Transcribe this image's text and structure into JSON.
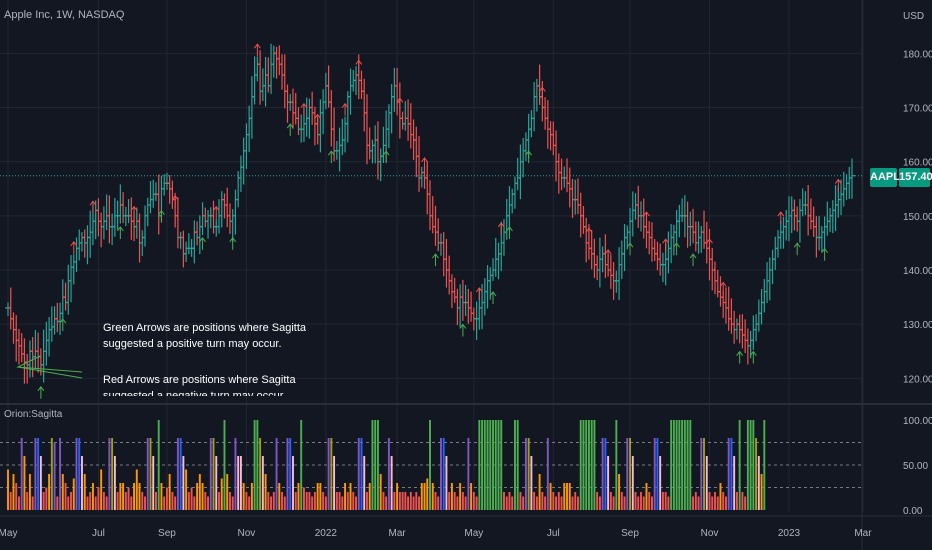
{
  "header": {
    "symbol": "Apple Inc, 1W, NASDAQ",
    "currency": "USD",
    "indicator": "Orion:Sagitta"
  },
  "badges": {
    "ticker": "AAPL",
    "last_price": "157.40"
  },
  "notes": {
    "green": "Green Arrows are positions where Sagitta suggested a positive turn may occur.",
    "red": "Red Arrows are positions where Sagitta suggested a negative turn may occur."
  },
  "colors": {
    "up": "#26a69a",
    "down": "#ef5350",
    "grid": "#222631",
    "arrow_up": "#4caf50",
    "arrow_down": "#ef5350",
    "hist_green": "#4caf50",
    "hist_red": "#ef5350",
    "hist_orange": "#ff9800",
    "hist_pink": "#f8bbd0",
    "hist_purple": "#7e57c2",
    "hist_blue": "#2962ff",
    "hist_olive": "#9e9d24",
    "last_line": "#26a69a"
  },
  "chart_data": [
    {
      "type": "ohlc",
      "title": "Apple Inc, 1W, NASDAQ",
      "x_axis": {
        "ticks": [
          "May",
          "Jul",
          "Sep",
          "Nov",
          "2022",
          "Mar",
          "May",
          "Jul",
          "Sep",
          "Nov",
          "2023",
          "Mar",
          "Ma"
        ],
        "tick_bar_index": [
          0,
          33,
          58,
          87,
          116,
          142,
          170,
          199,
          227,
          256,
          285,
          312,
          340
        ]
      },
      "y_axis": {
        "ticks": [
          120,
          130,
          140,
          150,
          160,
          170,
          180
        ],
        "unit": "USD",
        "ylim": [
          116,
          188
        ]
      },
      "last_price": 157.4,
      "closes": [
        133.0,
        131.0,
        129.0,
        127.0,
        126.0,
        124.5,
        123.0,
        122.5,
        125.0,
        124.0,
        125.0,
        124.0,
        122.5,
        125.0,
        127.0,
        129.0,
        129.5,
        131.0,
        130.5,
        132.0,
        135.0,
        134.0,
        138.0,
        140.5,
        141.5,
        144.0,
        145.0,
        146.0,
        145.0,
        146.0,
        147.0,
        149.0,
        151.0,
        149.0,
        148.0,
        149.0,
        150.0,
        148.0,
        148.0,
        150.0,
        150.0,
        152.0,
        150.0,
        150.0,
        150.0,
        149.0,
        148.0,
        149.0,
        145.0,
        146.0,
        150.0,
        152.0,
        153.0,
        154.0,
        154.0,
        150.0,
        155.0,
        156.0,
        156.0,
        155.0,
        153.0,
        150.0,
        146.0,
        146.0,
        143.0,
        144.0,
        144.0,
        144.0,
        147.0,
        146.0,
        148.0,
        150.0,
        149.0,
        150.0,
        150.0,
        148.0,
        148.0,
        150.0,
        153.0,
        152.0,
        150.0,
        149.0,
        150.0,
        153.0,
        157.0,
        159.0,
        162.0,
        165.0,
        168.0,
        172.0,
        176.0,
        178.0,
        173.0,
        174.0,
        176.0,
        174.0,
        178.0,
        180.0,
        179.0,
        178.0,
        176.0,
        173.0,
        171.0,
        171.0,
        169.0,
        168.0,
        166.0,
        166.0,
        167.0,
        168.0,
        170.0,
        169.0,
        167.0,
        165.0,
        169.0,
        171.0,
        174.0,
        171.0,
        166.0,
        162.0,
        162.0,
        163.0,
        164.0,
        167.0,
        172.0,
        174.0,
        175.0,
        176.0,
        175.0,
        173.0,
        169.0,
        163.0,
        162.0,
        163.0,
        164.0,
        160.0,
        161.0,
        163.0,
        166.0,
        169.0,
        172.0,
        174.0,
        171.0,
        168.0,
        167.0,
        168.0,
        167.0,
        165.0,
        164.0,
        161.0,
        157.0,
        158.0,
        157.0,
        154.0,
        150.0,
        148.0,
        147.0,
        145.0,
        145.0,
        142.0,
        140.0,
        138.0,
        136.0,
        135.0,
        133.0,
        135.0,
        134.0,
        134.0,
        133.0,
        132.0,
        131.0,
        131.0,
        133.0,
        134.0,
        136.0,
        138.0,
        139.0,
        140.0,
        142.0,
        143.0,
        145.0,
        147.0,
        150.0,
        152.0,
        154.0,
        156.0,
        157.0,
        160.0,
        162.0,
        164.0,
        166.0,
        168.0,
        172.0,
        174.0,
        172.0,
        170.0,
        168.0,
        166.0,
        165.0,
        163.0,
        160.0,
        158.0,
        157.0,
        157.0,
        156.0,
        155.0,
        153.0,
        153.0,
        152.0,
        150.0,
        148.0,
        145.0,
        144.0,
        143.0,
        141.0,
        140.0,
        142.0,
        143.0,
        141.0,
        140.0,
        139.0,
        138.0,
        138.0,
        141.0,
        143.0,
        146.0,
        147.0,
        149.0,
        151.0,
        152.0,
        150.0,
        150.0,
        148.0,
        147.0,
        146.0,
        144.0,
        143.0,
        142.0,
        141.0,
        141.0,
        142.0,
        144.0,
        146.0,
        147.0,
        149.0,
        150.0,
        150.0,
        150.0,
        148.0,
        148.0,
        147.0,
        145.0,
        146.0,
        147.0,
        145.0,
        144.0,
        142.0,
        140.0,
        138.0,
        136.0,
        135.0,
        134.0,
        133.0,
        131.0,
        130.0,
        129.0,
        130.0,
        129.0,
        128.0,
        127.0,
        126.0,
        127.0,
        129.0,
        130.0,
        132.0,
        134.0,
        136.0,
        138.0,
        140.0,
        142.0,
        144.0,
        146.0,
        147.0,
        148.0,
        149.0,
        150.0,
        151.0,
        150.0,
        149.0,
        151.0,
        152.0,
        152.0,
        150.0,
        149.0,
        148.0,
        146.0,
        146.0,
        147.0,
        148.0,
        149.0,
        150.0,
        151.0,
        152.0,
        153.0,
        154.0,
        155.0,
        156.0,
        157.0,
        157.4
      ],
      "arrows_up_bar_index": [
        12,
        20,
        41,
        56,
        71,
        82,
        103,
        118,
        138,
        156,
        166,
        177,
        183,
        190,
        227,
        244,
        250,
        267,
        272,
        288,
        298,
        311,
        333
      ],
      "arrows_down_bar_index": [
        24,
        31,
        46,
        61,
        76,
        91,
        108,
        113,
        123,
        128,
        143,
        152,
        172,
        180,
        195,
        212,
        219,
        233,
        240,
        256,
        261,
        282,
        303,
        316,
        321,
        326
      ]
    },
    {
      "type": "bar",
      "title": "Orion:Sagitta",
      "ylim": [
        0,
        100
      ],
      "y_axis": {
        "ticks": [
          "0.00",
          "50.00",
          "100.00"
        ]
      },
      "reference_lines": [
        25,
        50,
        75
      ],
      "x_axis": {
        "ticks": [
          "May",
          "Jul",
          "Sep",
          "Nov",
          "2022",
          "Mar",
          "May",
          "Jul",
          "Sep",
          "Nov",
          "2023",
          "Mar",
          "Ma"
        ],
        "tick_bar_index": [
          0,
          33,
          58,
          87,
          116,
          142,
          170,
          199,
          227,
          256,
          285,
          312,
          340
        ]
      },
      "levels": [
        "green",
        "red",
        "orange",
        "pink",
        "purple",
        "blue",
        "olive"
      ],
      "values": [
        45,
        20,
        40,
        30,
        15,
        80,
        60,
        20,
        40,
        15,
        80,
        80,
        60,
        20,
        25,
        40,
        80,
        75,
        15,
        80,
        40,
        30,
        15,
        20,
        35,
        80,
        80,
        60,
        40,
        15,
        20,
        30,
        15,
        25,
        45,
        20,
        15,
        80,
        80,
        60,
        20,
        30,
        30,
        20,
        25,
        15,
        30,
        45,
        30,
        20,
        15,
        80,
        80,
        60,
        20,
        100,
        30,
        15,
        25,
        40,
        20,
        15,
        80,
        80,
        60,
        45,
        20,
        25,
        15,
        30,
        40,
        30,
        20,
        15,
        80,
        80,
        60,
        20,
        35,
        100,
        40,
        20,
        15,
        80,
        60,
        60,
        30,
        20,
        15,
        30,
        100,
        100,
        80,
        60,
        40,
        20,
        15,
        20,
        80,
        30,
        20,
        15,
        80,
        80,
        60,
        20,
        30,
        100,
        25,
        20,
        20,
        15,
        20,
        30,
        30,
        20,
        15,
        80,
        80,
        60,
        20,
        20,
        15,
        30,
        20,
        30,
        20,
        15,
        80,
        80,
        60,
        20,
        30,
        100,
        100,
        100,
        40,
        20,
        15,
        80,
        60,
        20,
        30,
        20,
        20,
        20,
        15,
        20,
        15,
        20,
        15,
        30,
        30,
        35,
        100,
        30,
        20,
        15,
        80,
        80,
        60,
        20,
        30,
        20,
        15,
        30,
        20,
        15,
        80,
        30,
        20,
        15,
        100,
        100,
        100,
        100,
        100,
        100,
        100,
        100,
        100,
        20,
        15,
        20,
        15,
        100,
        100,
        20,
        15,
        80,
        80,
        60,
        20,
        15,
        40,
        20,
        15,
        80,
        30,
        20,
        15,
        20,
        15,
        30,
        30,
        30,
        15,
        20,
        15,
        100,
        100,
        100,
        100,
        100,
        100,
        20,
        15,
        80,
        80,
        60,
        20,
        15,
        100,
        40,
        20,
        15,
        80,
        80,
        60,
        20,
        15,
        20,
        15,
        30,
        20,
        15,
        80,
        80,
        60,
        20,
        20,
        15,
        100,
        100,
        100,
        100,
        100,
        100,
        100,
        100,
        15,
        20,
        15,
        80,
        80,
        60,
        20,
        15,
        20,
        15,
        30,
        20,
        15,
        80,
        80,
        60,
        20,
        100,
        20,
        15,
        100,
        100,
        100,
        80,
        60,
        40,
        100
      ],
      "colors": [
        "orange",
        "red",
        "orange",
        "red",
        "red",
        "purple",
        "orange",
        "red",
        "orange",
        "red",
        "purple",
        "blue",
        "pink",
        "red",
        "red",
        "orange",
        "olive",
        "purple",
        "red",
        "purple",
        "orange",
        "red",
        "red",
        "red",
        "orange",
        "purple",
        "blue",
        "pink",
        "orange",
        "red",
        "red",
        "orange",
        "red",
        "red",
        "orange",
        "red",
        "red",
        "purple",
        "olive",
        "pink",
        "red",
        "orange",
        "orange",
        "red",
        "red",
        "red",
        "orange",
        "orange",
        "orange",
        "red",
        "red",
        "purple",
        "olive",
        "pink",
        "red",
        "green",
        "orange",
        "red",
        "red",
        "orange",
        "red",
        "red",
        "purple",
        "blue",
        "pink",
        "orange",
        "red",
        "red",
        "red",
        "orange",
        "orange",
        "orange",
        "red",
        "red",
        "purple",
        "olive",
        "pink",
        "red",
        "orange",
        "green",
        "orange",
        "red",
        "red",
        "purple",
        "pink",
        "pink",
        "orange",
        "red",
        "red",
        "orange",
        "green",
        "green",
        "olive",
        "pink",
        "orange",
        "red",
        "red",
        "red",
        "purple",
        "orange",
        "red",
        "red",
        "purple",
        "blue",
        "pink",
        "red",
        "orange",
        "green",
        "red",
        "red",
        "red",
        "red",
        "red",
        "orange",
        "orange",
        "red",
        "red",
        "purple",
        "olive",
        "pink",
        "red",
        "red",
        "red",
        "orange",
        "red",
        "orange",
        "red",
        "red",
        "purple",
        "blue",
        "pink",
        "red",
        "orange",
        "green",
        "green",
        "green",
        "orange",
        "red",
        "red",
        "purple",
        "pink",
        "red",
        "orange",
        "red",
        "red",
        "red",
        "red",
        "red",
        "red",
        "red",
        "red",
        "orange",
        "orange",
        "orange",
        "green",
        "orange",
        "red",
        "red",
        "purple",
        "blue",
        "pink",
        "red",
        "orange",
        "red",
        "red",
        "orange",
        "red",
        "red",
        "purple",
        "orange",
        "red",
        "red",
        "green",
        "green",
        "green",
        "green",
        "green",
        "green",
        "green",
        "green",
        "green",
        "red",
        "red",
        "red",
        "red",
        "green",
        "green",
        "red",
        "red",
        "purple",
        "olive",
        "pink",
        "red",
        "red",
        "orange",
        "red",
        "red",
        "purple",
        "orange",
        "red",
        "red",
        "red",
        "red",
        "orange",
        "orange",
        "orange",
        "red",
        "red",
        "red",
        "green",
        "green",
        "green",
        "green",
        "green",
        "green",
        "red",
        "red",
        "purple",
        "blue",
        "pink",
        "red",
        "red",
        "green",
        "orange",
        "red",
        "red",
        "purple",
        "olive",
        "pink",
        "red",
        "red",
        "red",
        "red",
        "orange",
        "red",
        "red",
        "purple",
        "blue",
        "pink",
        "red",
        "red",
        "red",
        "green",
        "green",
        "green",
        "green",
        "green",
        "green",
        "green",
        "green",
        "red",
        "red",
        "red",
        "purple",
        "olive",
        "pink",
        "red",
        "red",
        "red",
        "red",
        "orange",
        "red",
        "red",
        "purple",
        "blue",
        "pink",
        "red",
        "green",
        "red",
        "red",
        "green",
        "green",
        "green",
        "olive",
        "pink",
        "orange",
        "green"
      ]
    }
  ]
}
